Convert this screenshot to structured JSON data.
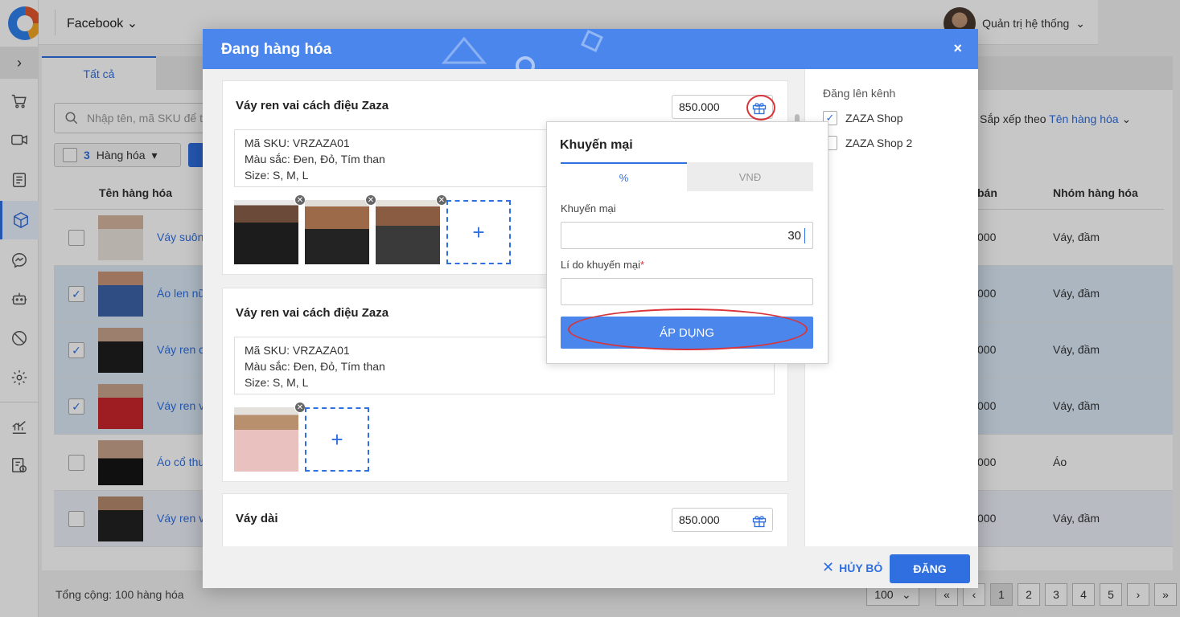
{
  "app": {
    "channel": "Facebook",
    "user_name": "Quản trị hệ thống"
  },
  "sidebar": {
    "items": [
      "cart-icon",
      "video-icon",
      "orders-icon",
      "box-icon",
      "messenger-icon",
      "bot-icon",
      "block-icon",
      "gear-icon",
      "chart-icon",
      "report-icon"
    ],
    "active": "box-icon"
  },
  "background": {
    "tab_all": "Tất cả",
    "search_placeholder": "Nhập tên, mã SKU để t",
    "selected_count": "3",
    "selected_label": "Hàng hóa",
    "sort_label": "Sắp xếp theo",
    "sort_value": "Tên hàng hóa",
    "col_name": "Tên hàng hóa",
    "col_price": "bán",
    "col_group": "Nhóm hàng hóa",
    "rows": [
      {
        "name": "Váy suôn",
        "price": "000",
        "group": "Váy, đầm",
        "checked": false
      },
      {
        "name": "Áo len nữ",
        "price": "000",
        "group": "Váy, đầm",
        "checked": true
      },
      {
        "name": "Váy ren c",
        "price": "000",
        "group": "Váy, đầm",
        "checked": true
      },
      {
        "name": "Váy ren v",
        "price": "000",
        "group": "Váy, đầm",
        "checked": true
      },
      {
        "name": "Áo cổ thu",
        "price": "000",
        "group": "Áo",
        "checked": false
      },
      {
        "name": "Váy ren v",
        "price": "000",
        "group": "Váy, đầm",
        "checked": false
      }
    ],
    "total": "Tổng cộng: 100 hàng hóa",
    "page_size": "100",
    "pages": [
      "1",
      "2",
      "3",
      "4",
      "5"
    ],
    "current_page": "1"
  },
  "modal": {
    "title": "Đang hàng hóa",
    "close": "×",
    "channels_title": "Đăng lên kênh",
    "channels": [
      {
        "name": "ZAZA Shop",
        "checked": true
      },
      {
        "name": "ZAZA Shop 2",
        "checked": false
      }
    ],
    "cancel_label": "HỦY BỎ",
    "post_label": "ĐĂNG",
    "products": [
      {
        "title": "Váy ren vai cách điệu Zaza",
        "price": "850.000",
        "sku": "Mã SKU: VRZAZA01",
        "color": "Màu sắc: Đen, Đỏ, Tím than",
        "size": "Size: S, M, L"
      },
      {
        "title": "Váy ren vai cách điệu Zaza",
        "sku": "Mã SKU: VRZAZA01",
        "color": "Màu sắc: Đen, Đỏ, Tím than",
        "size": "Size: S, M, L"
      },
      {
        "title": "Váy dài",
        "price": "850.000"
      }
    ]
  },
  "promo": {
    "title": "Khuyến mại",
    "tab_percent": "%",
    "tab_vnd": "VNĐ",
    "amount_label": "Khuyến mại",
    "amount_value": "30",
    "reason_label": "Lí do khuyến mại",
    "required_mark": "*",
    "apply_label": "ÁP DỤNG"
  },
  "colors": {
    "primary": "#2f6fe0",
    "header": "#4a86ec",
    "highlight_ring": "#d9343a"
  }
}
